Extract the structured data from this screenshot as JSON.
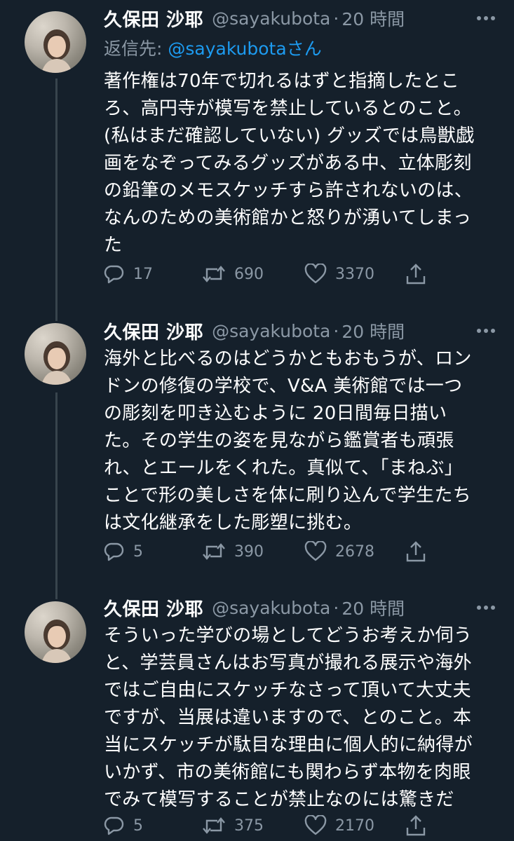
{
  "tweets": [
    {
      "name": "久保田 沙耶",
      "handle": "@sayakubota",
      "dot": "·",
      "time": "20 時間",
      "reply_label": "返信先: ",
      "reply_mention": "@sayakubota",
      "reply_suffix": "さん",
      "lines": [
        "著作権は70年で切れるはずと指摘したとこ",
        "ろ、高円寺が模写を禁止しているとのこと。",
        "(私はまだ確認していない) グッズでは鳥獣戯",
        "画をなぞってみるグッズがある中、立体彫刻",
        "の鉛筆のメモスケッチすら許されないのは、",
        "なんのための美術館かと怒りが湧いてしまっ",
        "た"
      ],
      "replies": "17",
      "retweets": "690",
      "likes": "3370"
    },
    {
      "name": "久保田 沙耶",
      "handle": "@sayakubota",
      "dot": "·",
      "time": "20 時間",
      "lines": [
        "海外と比べるのはどうかともおもうが、ロン",
        "ドンの修復の学校で、V&A 美術館では一つ",
        "の彫刻を叩き込むように 20日間毎日描い",
        "た。その学生の姿を見ながら鑑賞者も頑張",
        "れ、とエールをくれた。真似て、「まねぶ」",
        "ことで形の美しさを体に刷り込んで学生たち",
        "は文化継承をした彫塑に挑む。"
      ],
      "replies": "5",
      "retweets": "390",
      "likes": "2678"
    },
    {
      "name": "久保田 沙耶",
      "handle": "@sayakubota",
      "dot": "·",
      "time": "20 時間",
      "lines": [
        "そういった学びの場としてどうお考えか伺う",
        "と、学芸員さんはお写真が撮れる展示や海外",
        "ではご自由にスケッチなさって頂いて大丈夫",
        "ですが、当展は違いますので、とのこと。本",
        "当にスケッチが駄目な理由に個人的に納得が",
        "いかず、市の美術館にも関わらず本物を肉眼",
        "でみて模写することが禁止なのには驚きだ"
      ],
      "replies": "5",
      "retweets": "375",
      "likes": "2170"
    }
  ],
  "icons": {
    "reply": "reply-icon",
    "retweet": "retweet-icon",
    "like": "heart-icon",
    "share": "share-icon",
    "more": "more-icon"
  },
  "colors": {
    "background": "#15202b",
    "text": "#ffffff",
    "secondary": "#8b98a5",
    "accent": "#1d9bf0",
    "thread_line": "#38444d"
  }
}
